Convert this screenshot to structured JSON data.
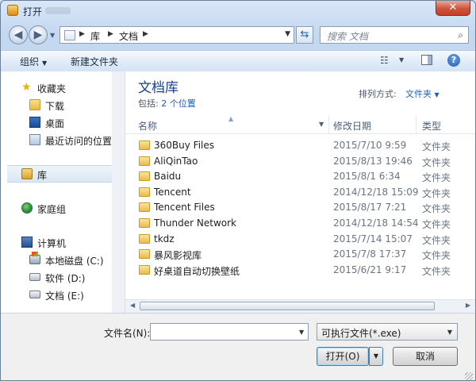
{
  "window": {
    "title": "打开",
    "close_label": "✕"
  },
  "nav": {
    "breadcrumb": [
      "库",
      "文档"
    ],
    "search_placeholder": "搜索 文档"
  },
  "toolbar": {
    "organize": "组织",
    "new_folder": "新建文件夹"
  },
  "sidebar": {
    "favorites": {
      "label": "收藏夹",
      "items": [
        "下载",
        "桌面",
        "最近访问的位置"
      ]
    },
    "libraries": "库",
    "homegroup": "家庭组",
    "computer": {
      "label": "计算机",
      "items": [
        "本地磁盘 (C:)",
        "软件 (D:)",
        "文档 (E:)"
      ]
    }
  },
  "library": {
    "title": "文档库",
    "includes_label": "包括:",
    "includes_link": "2 个位置",
    "arrange_label": "排列方式:",
    "arrange_value": "文件夹"
  },
  "columns": {
    "name": "名称",
    "date": "修改日期",
    "type": "类型"
  },
  "files": [
    {
      "name": "360Buy Files",
      "date": "2015/7/10 9:59",
      "type": "文件夹"
    },
    {
      "name": "AliQinTao",
      "date": "2015/8/13 19:46",
      "type": "文件夹"
    },
    {
      "name": "Baidu",
      "date": "2015/8/1 6:34",
      "type": "文件夹"
    },
    {
      "name": "Tencent",
      "date": "2014/12/18 15:09",
      "type": "文件夹"
    },
    {
      "name": "Tencent Files",
      "date": "2015/8/17 7:21",
      "type": "文件夹"
    },
    {
      "name": "Thunder Network",
      "date": "2014/12/18 14:54",
      "type": "文件夹"
    },
    {
      "name": "tkdz",
      "date": "2015/7/14 15:07",
      "type": "文件夹"
    },
    {
      "name": "暴风影视库",
      "date": "2015/7/8 17:37",
      "type": "文件夹"
    },
    {
      "name": "好桌道自动切换壁纸",
      "date": "2015/6/21 9:17",
      "type": "文件夹"
    }
  ],
  "bottom": {
    "filename_label": "文件名(N):",
    "filename_value": "",
    "filetype": "可执行文件(*.exe)",
    "open": "打开(O)",
    "cancel": "取消"
  }
}
